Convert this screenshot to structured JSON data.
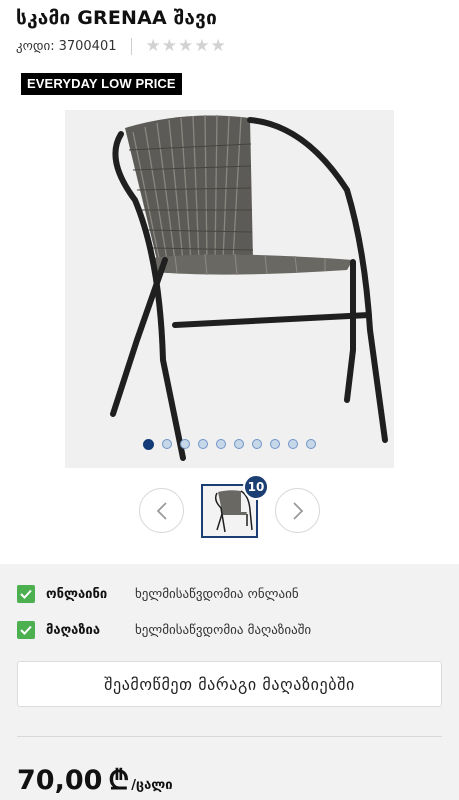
{
  "product": {
    "title": "სკამი GRENAA შავი",
    "code_label": "კოდი:",
    "code_value": "3700401",
    "rating_stars": 0,
    "rating_max": 5,
    "badge": "EVERYDAY LOW PRICE"
  },
  "gallery": {
    "slides_total": 10,
    "active_slide": 1,
    "thumb_count": "10"
  },
  "availability": [
    {
      "label": "ონლაინი",
      "status": "ხელმისაწვდომია ონლაინ",
      "checked": true
    },
    {
      "label": "მაღაზია",
      "status": "ხელმისაწვდომია მაღაზიაში",
      "checked": true
    }
  ],
  "actions": {
    "check_stores_label": "შეამოწმეთ მარაგი მაღაზიებში"
  },
  "price": {
    "value": "70,00",
    "currency": "₾",
    "unit": "/ცალი"
  },
  "colors": {
    "accent": "#1b3e73",
    "check_green": "#4caf50",
    "badge_bg": "#000000"
  }
}
